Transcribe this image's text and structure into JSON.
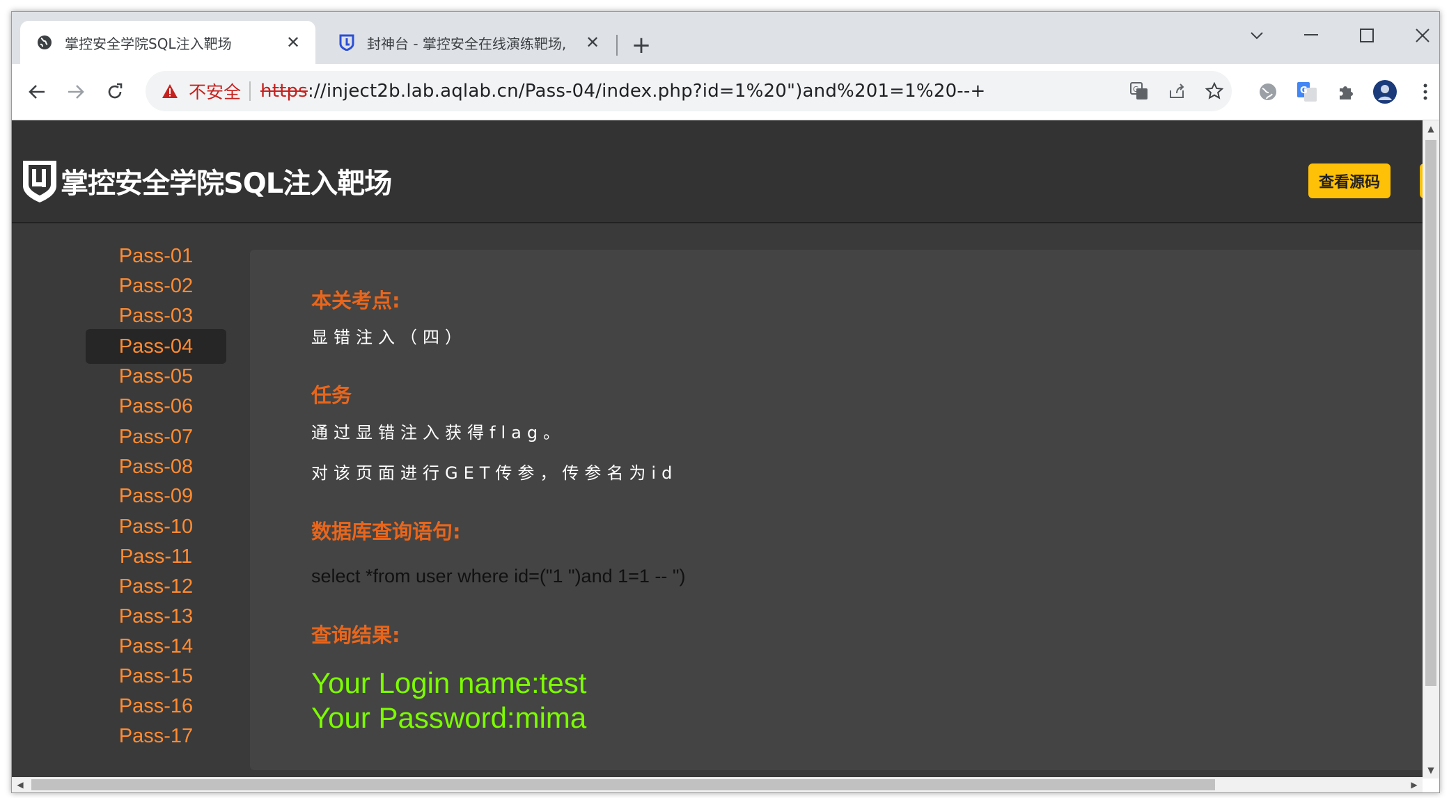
{
  "browser": {
    "tabs": [
      {
        "title": "掌控安全学院SQL注入靶场",
        "active": true
      },
      {
        "title": "封神台 - 掌控安全在线演练靶场,",
        "active": false
      }
    ],
    "new_tab_label": "+",
    "close_glyph": "✕",
    "not_secure_label": "不安全",
    "url_scheme": "https",
    "url_rest": "://inject2b.lab.aqlab.cn/Pass-04/index.php?id=1%20\")and%201=1%20--+"
  },
  "site": {
    "brand": "掌控安全学院SQL注入靶场",
    "view_source_label": "查看源码",
    "nav": [
      {
        "label": "Pass-01"
      },
      {
        "label": "Pass-02"
      },
      {
        "label": "Pass-03"
      },
      {
        "label": "Pass-04"
      },
      {
        "label": "Pass-05"
      },
      {
        "label": "Pass-06"
      },
      {
        "label": "Pass-07"
      },
      {
        "label": "Pass-08"
      },
      {
        "label": "Pass-09"
      },
      {
        "label": "Pass-10"
      },
      {
        "label": "Pass-11"
      },
      {
        "label": "Pass-12"
      },
      {
        "label": "Pass-13"
      },
      {
        "label": "Pass-14"
      },
      {
        "label": "Pass-15"
      },
      {
        "label": "Pass-16"
      },
      {
        "label": "Pass-17"
      }
    ],
    "active_nav": "Pass-04"
  },
  "content": {
    "heading_points": "本关考点:",
    "points_text": "显错注入（四）",
    "heading_task": "任务",
    "task_line1": "通过显错注入获得flag。",
    "task_line2": "对该页面进行GET传参，传参名为id",
    "heading_query": "数据库查询语句:",
    "query": "select *from user where id=(\"1 \")and 1=1 -- \")",
    "heading_result": "查询结果:",
    "result_line1": "Your Login name:test",
    "result_line2": "Your Password:mima"
  },
  "colors": {
    "accent_orange": "#e8661c",
    "nav_link": "#ff8c33",
    "result_green": "#7cfc00",
    "button_yellow": "#ffc107"
  }
}
